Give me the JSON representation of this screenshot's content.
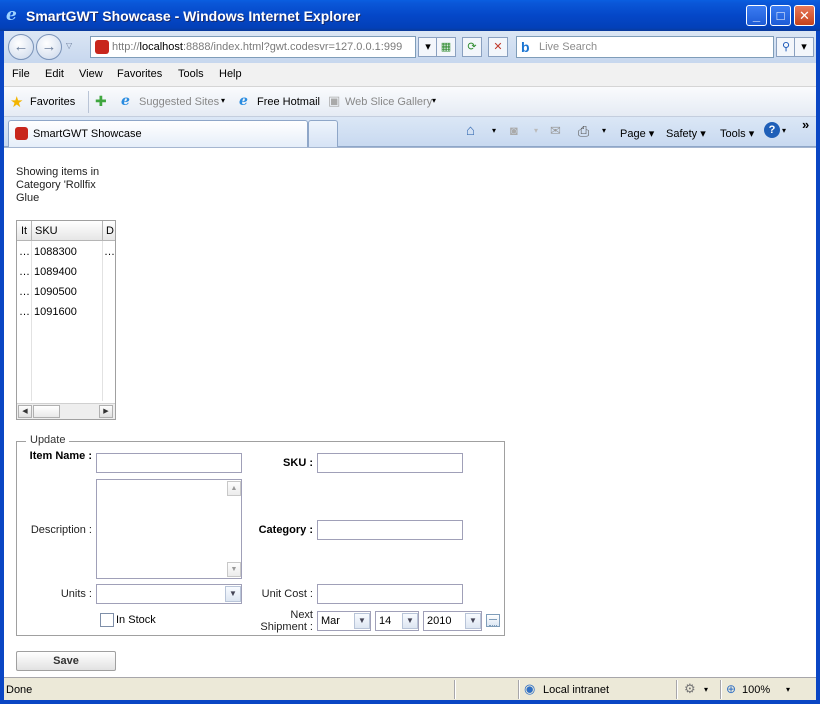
{
  "window": {
    "title": "SmartGWT Showcase - Windows Internet Explorer"
  },
  "address": {
    "url_prefix": "http://",
    "url_host": "localhost",
    "url_rest": ":8888/index.html?gwt.codesvr=127.0.0.1:999"
  },
  "search": {
    "placeholder": "Live Search"
  },
  "menu": [
    "File",
    "Edit",
    "View",
    "Favorites",
    "Tools",
    "Help"
  ],
  "favorites": {
    "label": "Favorites",
    "links": [
      "Suggested Sites",
      "Free Hotmail",
      "Web Slice Gallery"
    ]
  },
  "tab": {
    "label": "SmartGWT Showcase"
  },
  "commands": {
    "page": "Page",
    "safety": "Safety",
    "tools": "Tools",
    "more": "»"
  },
  "page": {
    "showing_label": "Showing items in Category 'Rollfix Glue",
    "grid": {
      "columns": [
        "It",
        "SKU",
        "D"
      ],
      "rows": [
        {
          "item": "…",
          "sku": "1088300",
          "desc": "…"
        },
        {
          "item": "…",
          "sku": "1089400",
          "desc": ""
        },
        {
          "item": "…",
          "sku": "1090500",
          "desc": ""
        },
        {
          "item": "…",
          "sku": "1091600",
          "desc": ""
        }
      ]
    },
    "form": {
      "legend": "Update",
      "item_name_label": "Item Name :",
      "sku_label": "SKU :",
      "description_label": "Description :",
      "category_label": "Category :",
      "units_label": "Units :",
      "unit_cost_label": "Unit Cost :",
      "in_stock_label": "In Stock",
      "next_shipment_label": "Next Shipment :",
      "date": {
        "month": "Mar",
        "day": "14",
        "year": "2010"
      }
    },
    "save_label": "Save"
  },
  "status": {
    "text": "Done",
    "zone": "Local intranet",
    "zoom": "100%"
  },
  "colors": {
    "title_bar": "#0447c8",
    "frame": "#0a46c4"
  }
}
